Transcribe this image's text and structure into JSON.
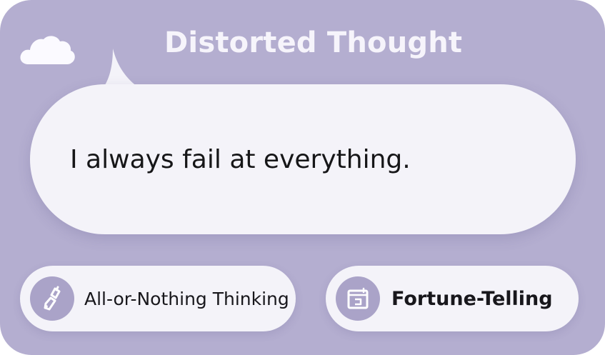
{
  "header": {
    "title": "Distorted Thought",
    "icon": "cloud-icon"
  },
  "thought": {
    "text": "I always fail at everything."
  },
  "distortions": [
    {
      "label": "All-or-Nothing Thinking",
      "icon": "broken-pencil-icon"
    },
    {
      "label": "Fortune-Telling",
      "icon": "calendar-icon"
    }
  ],
  "colors": {
    "card_background": "#b4aed0",
    "bubble_background": "#f4f3f9",
    "icon_circle": "#aaa3c8",
    "title_text": "#f6f4fb",
    "body_text": "#161618"
  }
}
